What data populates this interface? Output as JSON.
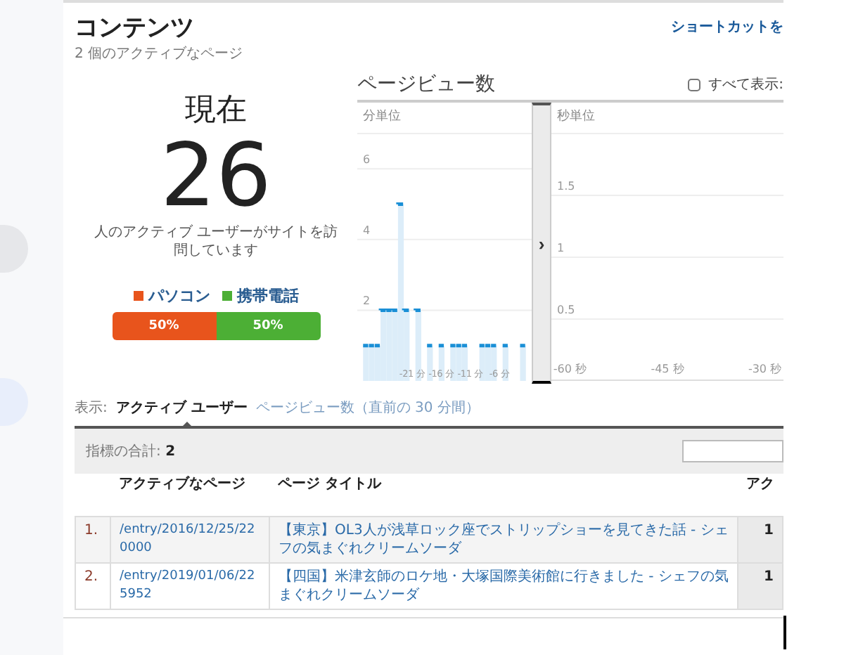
{
  "header": {
    "title": "コンテンツ",
    "subtitle": "2 個のアクティブなページ",
    "shortcut_link": "ショートカットを"
  },
  "summary": {
    "label": "現在",
    "count": "26",
    "caption": "人のアクティブ ユーザーがサイトを訪問しています",
    "devices": [
      {
        "label": "パソコン",
        "color": "#e8541c",
        "level": 0.5,
        "reading": "50%"
      },
      {
        "label": "携帯電話",
        "color": "#4caf35",
        "level": 0.5,
        "reading": "50%"
      }
    ]
  },
  "pageviews": {
    "title": "ページビュー数",
    "show_all": {
      "label": "すべて表示:",
      "checked": false
    },
    "minutes": {
      "label": "分単位",
      "chart_data": {
        "type": "bar",
        "grid": true,
        "xlim": [
          -30.5,
          -0.5
        ],
        "ylim": [
          0,
          7
        ],
        "x": [
          -30,
          -29,
          -28,
          -27,
          -26,
          -25,
          -24,
          -23,
          -22,
          -21,
          -20,
          -19,
          -18,
          -17,
          -16,
          -15,
          -14,
          -13,
          -12,
          -11,
          -10,
          -9,
          -8,
          -7,
          -6,
          -5,
          -4,
          -3,
          -2,
          -1
        ],
        "values": [
          0,
          1,
          1,
          1,
          2,
          2,
          2,
          5,
          2,
          0,
          2,
          0,
          1,
          0,
          1,
          0,
          1,
          1,
          1,
          0,
          0,
          1,
          1,
          1,
          0,
          1,
          0,
          0,
          1,
          0
        ],
        "yticks": [
          {
            "value": 2,
            "label": "2"
          },
          {
            "value": 4,
            "label": "4"
          },
          {
            "value": 6,
            "label": "6"
          }
        ],
        "xticks": [
          {
            "value": -21,
            "label": "-21 分"
          },
          {
            "value": -16,
            "label": "-16 分"
          },
          {
            "value": -11,
            "label": "-11 分"
          },
          {
            "value": -6,
            "label": "-6 分"
          }
        ]
      }
    },
    "seconds": {
      "label": "秒単位",
      "chart_data": {
        "type": "line",
        "grid": true,
        "ylim": [
          0,
          2
        ],
        "yticks": [
          {
            "value": 0.5,
            "label": "0.5"
          },
          {
            "value": 1,
            "label": "1"
          },
          {
            "value": 1.5,
            "label": "1.5"
          }
        ],
        "xticks": [
          {
            "value": -60,
            "label": "-60 秒"
          },
          {
            "value": -45,
            "label": "-45 秒"
          },
          {
            "value": -30,
            "label": "-30 秒"
          }
        ],
        "xlim": [
          -62,
          -28
        ]
      }
    },
    "expand_glyph": "›"
  },
  "view": {
    "label": "表示:",
    "tabs": [
      {
        "label": "アクティブ ユーザー",
        "selected": true
      },
      {
        "label": "ページビュー数（直前の 30 分間）",
        "selected": false
      }
    ]
  },
  "table": {
    "total_label": "指標の合計:",
    "total_value": "2",
    "columns": [
      "アクティブなページ",
      "ページ タイトル",
      "アク"
    ],
    "rows": [
      {
        "index": "1.",
        "page": "/entry/2016/12/25/220000",
        "title": "【東京】OL3人が浅草ロック座でストリップショーを見てきた話 - シェフの気まぐれクリームソーダ",
        "value": "1"
      },
      {
        "index": "2.",
        "page": "/entry/2019/01/06/225952",
        "title": "【四国】米津玄師のロケ地・大塚国際美術館に行きました - シェフの気まぐれクリームソーダ",
        "value": "1"
      }
    ]
  }
}
